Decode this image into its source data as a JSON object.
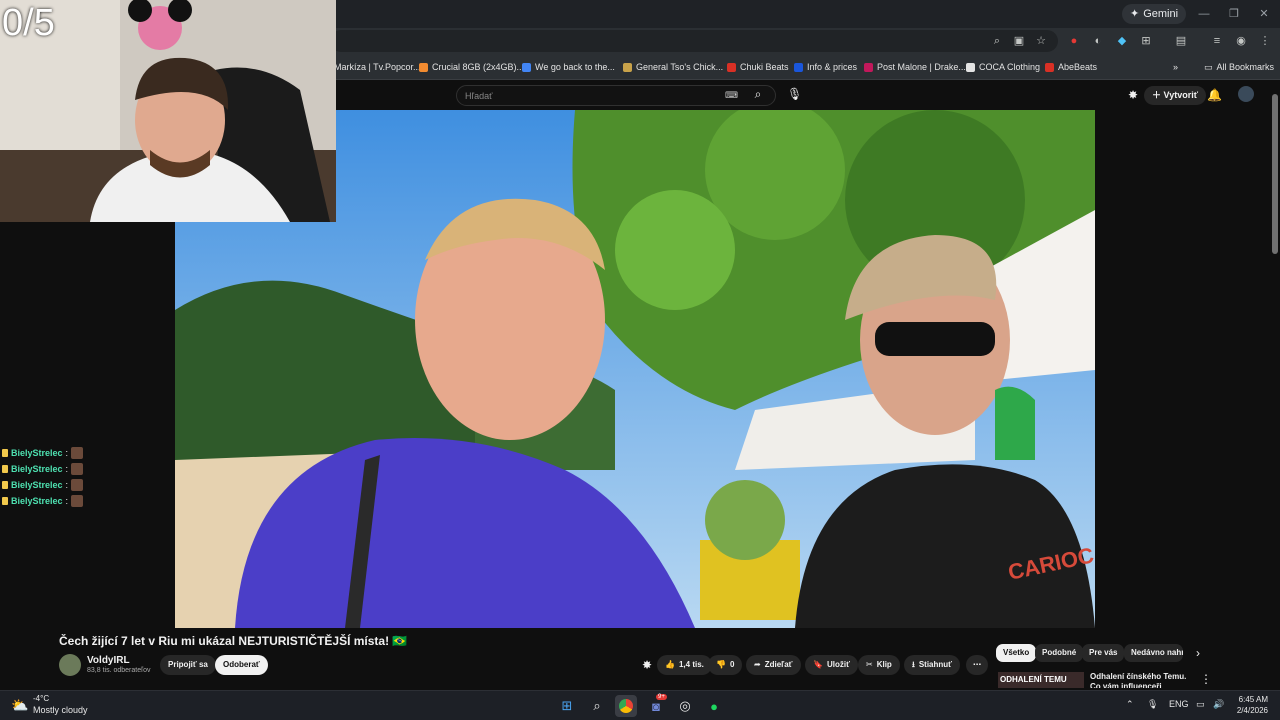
{
  "browser": {
    "gemini_label": "Gemini",
    "bookmarks": [
      {
        "label": "Markíza | Tv.Popcor...",
        "color": "#2b2f33"
      },
      {
        "label": "Crucial 8GB (2x4GB)...",
        "color": "#f28b30"
      },
      {
        "label": "We go back to the...",
        "color": "#4285f4"
      },
      {
        "label": "General Tso's Chick...",
        "color": "#c8a24a"
      },
      {
        "label": "Chuki Beats",
        "color": "#d93025"
      },
      {
        "label": "Info & prices",
        "color": "#1a56db"
      },
      {
        "label": "Post Malone | Drake...",
        "color": "#c2185b"
      },
      {
        "label": "COCA Clothing",
        "color": "#e3e3e3"
      },
      {
        "label": "AbeBeats",
        "color": "#d93025"
      }
    ],
    "all_bookmarks_label": "All Bookmarks"
  },
  "youtube": {
    "search_placeholder": "Hľadať",
    "create_label": "Vytvoriť",
    "video": {
      "title": "Čech žijící 7 let v Riu mi ukázal NEJTURISTIČTĚJŠÍ místa! 🇧🇷",
      "channel": "VoldyIRL",
      "subscribers": "83,8 tis. odberateľov",
      "join_label": "Pripojiť sa",
      "subscribe_label": "Odoberať",
      "likes": "1,4 tis.",
      "dislikes": "0",
      "share_label": "Zdieľať",
      "save_label": "Uložiť",
      "clip_label": "Klip",
      "download_label": "Stiahnuť"
    },
    "chips": [
      "Všetko",
      "Podobné",
      "Pre vás",
      "Nedávno nahr"
    ],
    "recommendation": {
      "thumb_text": "ODHALENÍ TEMU",
      "title": "Odhalení čínského Temu. Co vám influenceři neřeknou?"
    }
  },
  "stream_overlay": {
    "counter": "0/5",
    "chat": [
      {
        "user": "BielyStrelec"
      },
      {
        "user": "BielyStrelec"
      },
      {
        "user": "BielyStrelec"
      },
      {
        "user": "BielyStrelec"
      }
    ]
  },
  "taskbar": {
    "temperature": "-4°C",
    "weather": "Mostly cloudy",
    "language": "ENG",
    "time": "6:45 AM",
    "date": "2/4/2026",
    "discord_badge": "9+"
  }
}
